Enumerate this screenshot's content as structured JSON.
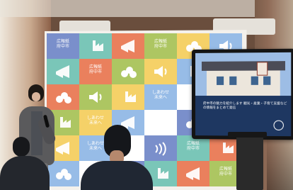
{
  "image": {
    "objects": [
      "room",
      "backdrop",
      "presentation-screen",
      "speaker",
      "audience"
    ],
    "colors": {
      "wall": "#6b4d3a",
      "backdrop_tile_colors": [
        "#6f87c8",
        "#6fc3b3",
        "#e97751",
        "#a6c356",
        "#f5cf5d",
        "#8fb8e7",
        "#ffffff"
      ],
      "screen_bezel": "#1b1b1b",
      "screen_content": "#9ab9df",
      "speaker_jacket": "#58575a",
      "audience_hair": "#15171b"
    }
  },
  "backdrop": {
    "tiles": [
      {
        "type": "text",
        "text": "広報紙\n府中市"
      },
      {
        "type": "factory-icon"
      },
      {
        "type": "megaphone-icon"
      },
      {
        "type": "text",
        "text": "広報紙\n府中市"
      },
      {
        "type": "leaf-icon"
      },
      {
        "type": "speaker-icon"
      },
      {
        "type": "factory-icon"
      },
      {
        "type": "text",
        "text": "しあわせ\n未来へ"
      },
      {
        "type": "megaphone-icon"
      },
      {
        "type": "text",
        "text": "しあわせ\n未来へ"
      },
      {
        "type": "leaf-icon"
      },
      {
        "type": "wave-icon"
      }
    ]
  },
  "presentation": {
    "screen_text": "府中市の魅力を紹介します\n観光・産業・子育て支援などの情報をまとめて発信"
  }
}
